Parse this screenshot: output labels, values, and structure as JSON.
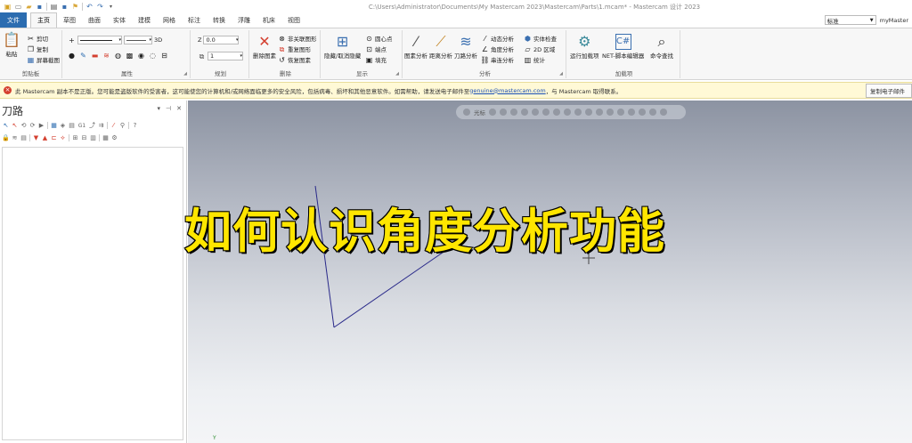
{
  "window": {
    "title": "C:\\Users\\Administrator\\Documents\\My Mastercam 2023\\Mastercam\\Parts\\1.mcam* - Mastercam 设计 2023"
  },
  "tabs": [
    "文件",
    "主页",
    "草图",
    "曲面",
    "实体",
    "建模",
    "网格",
    "标注",
    "转换",
    "浮雕",
    "机床",
    "视图"
  ],
  "tabs_active": "主页",
  "top_right": {
    "mode_select": "标准",
    "user": "myMaster"
  },
  "ribbon": {
    "clipboard": {
      "paste": "粘贴",
      "cut": "剪切",
      "copy": "复制",
      "screenshot": "屏幕截图",
      "label": "剪贴板"
    },
    "attributes": {
      "label": "属性",
      "dim": "3D"
    },
    "planning": {
      "z_label": "Z",
      "z_value": "0.0",
      "level_value": "1",
      "label": "规划"
    },
    "delete": {
      "delete_btn": "删除图素",
      "undelete": "非关联图形",
      "repeat": "重复图形",
      "restore": "恢复图素",
      "label": "删除"
    },
    "display": {
      "hide": "隐藏/取消隐藏",
      "center": "圆心点",
      "endpoint": "端点",
      "fill": "填充",
      "label": "显示"
    },
    "analysis": {
      "geometry": "图素分析",
      "distance": "距离分析",
      "toolpath": "刀路分析",
      "dynamic": "动态分析",
      "angle": "角度分析",
      "chain": "串连分析",
      "solid_check": "实体检查",
      "area_2d": "2D 区域",
      "stats": "统计",
      "label": "分析"
    },
    "addins": {
      "run": "运行加载项",
      "net_editor": "NET-脚本编辑器",
      "cmd_find": "命令查找",
      "label": "加载项"
    }
  },
  "warning": {
    "text": "此 Mastercam 副本不是正版。您可能是盗版软件的受害者，这可能使您的计算机和/或网络面临更多的安全风险，包括病毒、损坏和其他恶意软件。如需帮助，请发送电子邮件至",
    "email": "genuine@mastercam.com",
    "tail": "，与 Mastercam 取得联系。",
    "button": "复制电子邮件"
  },
  "panel": {
    "title": "刀路"
  },
  "viewport": {
    "toolbar_label": "光标",
    "overlay_title": "如何认识角度分析功能",
    "axis_label": "Y"
  }
}
